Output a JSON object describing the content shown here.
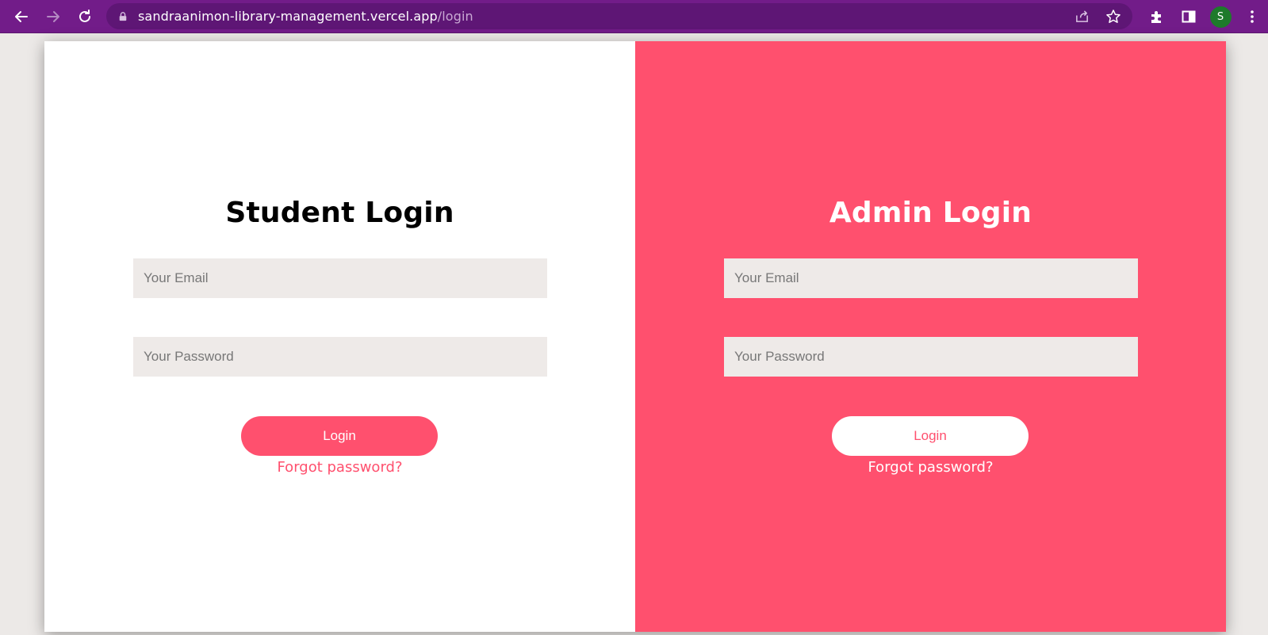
{
  "browser": {
    "url_host": "sandraanimon-library-management.vercel.app",
    "url_path": "/login",
    "profile_initial": "S",
    "colors": {
      "frame": "#721C89",
      "omnibox": "#5E1675",
      "avatar": "#1E7A2B"
    }
  },
  "student": {
    "title": "Student Login",
    "email_placeholder": "Your Email",
    "password_placeholder": "Your Password",
    "login_label": "Login",
    "forgot_label": "Forgot password?"
  },
  "admin": {
    "title": "Admin Login",
    "email_placeholder": "Your Email",
    "password_placeholder": "Your Password",
    "login_label": "Login",
    "forgot_label": "Forgot password?"
  },
  "colors": {
    "accent": "#FF506E",
    "input_bg": "#EEEAE8",
    "page_bg": "#ECE9E7"
  }
}
